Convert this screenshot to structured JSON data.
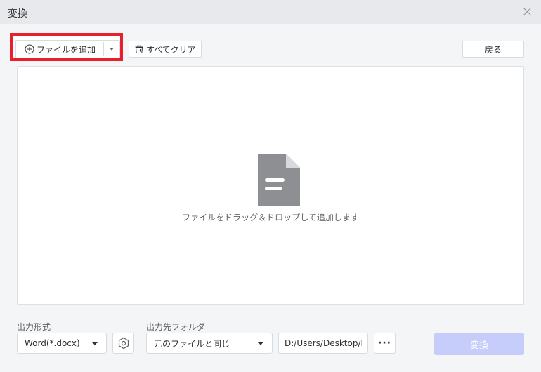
{
  "window": {
    "title": "変換"
  },
  "toolbar": {
    "add_file_label": "ファイルを追加",
    "clear_all_label": "すべてクリア",
    "back_label": "戻る"
  },
  "dropzone": {
    "hint": "ファイルをドラッグ＆ドロップして追加します"
  },
  "output": {
    "format_label": "出力形式",
    "format_value": "Word(*.docx)",
    "folder_label": "出力先フォルダ",
    "folder_mode": "元のファイルと同じ",
    "folder_path": "D:/Users/Desktop/PDF",
    "browse_label": "···",
    "convert_label": "変換"
  },
  "colors": {
    "highlight": "#e8202c",
    "convert_disabled": "#c7cdfb",
    "file_icon": "#8e8f93"
  },
  "icons": [
    "close-icon",
    "plus-circle-icon",
    "dropdown-caret-icon",
    "trash-icon",
    "file-document-icon",
    "settings-hexagon-icon",
    "more-dots-icon"
  ]
}
